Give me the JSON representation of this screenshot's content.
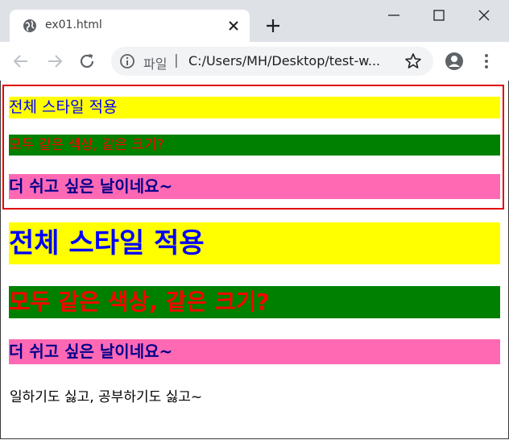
{
  "tab": {
    "title": "ex01.html",
    "icon": "globe-icon"
  },
  "omnibox": {
    "scheme_label": "파일",
    "separator": "|",
    "url": "C:/Users/MH/Desktop/test-w..."
  },
  "content": {
    "box_line_1": "전체 스타일 적용",
    "box_line_2": "모두 같은 색상, 같은 크기?",
    "box_line_3": "더 쉬고 싶은 날이네요~",
    "line_4": "전체 스타일 적용",
    "line_5": "모두 같은 색상, 같은 크기?",
    "line_6": "더 쉬고 싶은 날이네요~",
    "line_7": "일하기도 싫고, 공부하기도 싫고~"
  },
  "colors": {
    "yellow_bg": "#ffff00",
    "blue_text": "#0000ff",
    "green_bg": "#008000",
    "red_text": "#ff0000",
    "pink_bg": "#ff69b4",
    "navy_text": "#00008b",
    "highlight_border": "#e00000"
  }
}
